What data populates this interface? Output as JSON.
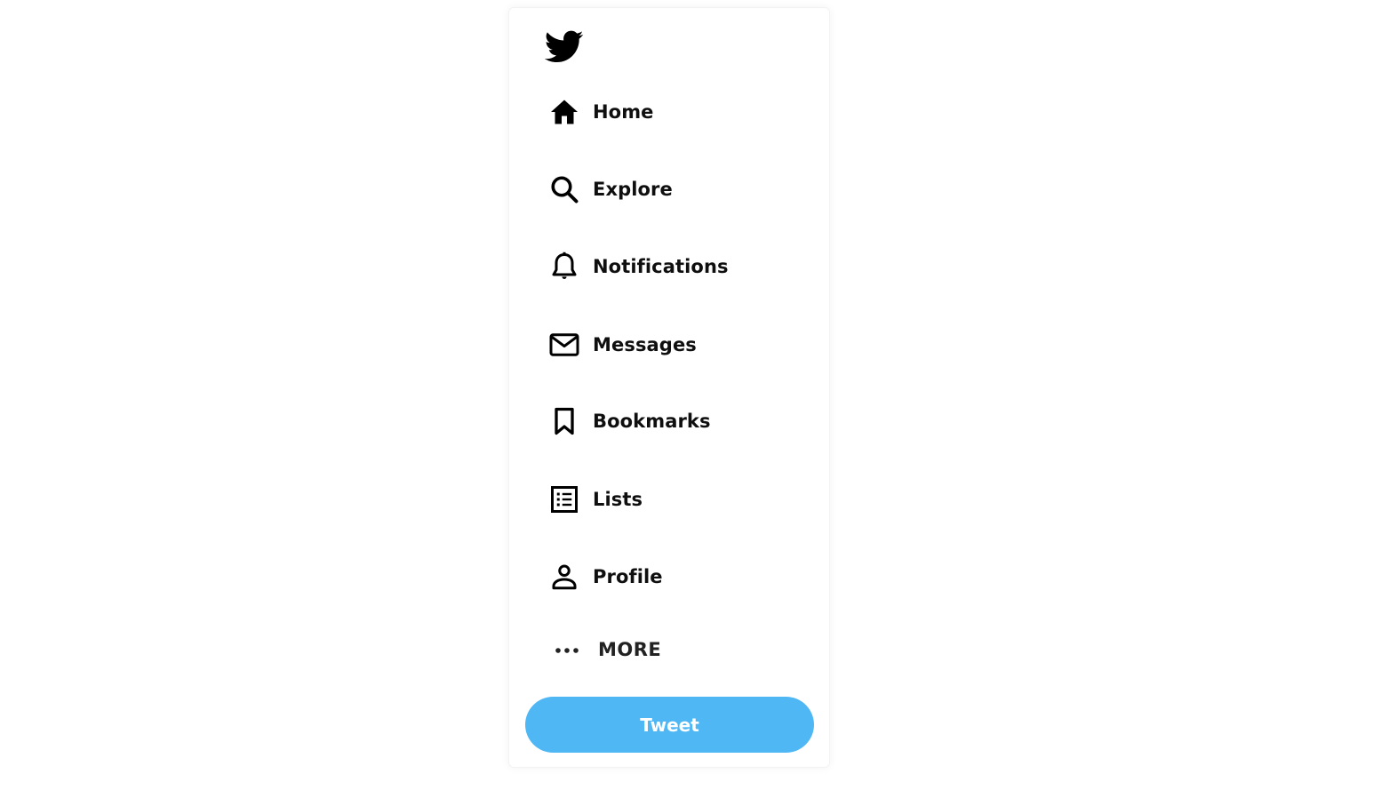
{
  "colors": {
    "accent": "#50b7f5",
    "text": "#0f0f0f",
    "background": "#ffffff"
  },
  "logo": {
    "icon": "twitter-bird-icon"
  },
  "nav": {
    "items": [
      {
        "label": "Home",
        "icon": "home-icon"
      },
      {
        "label": "Explore",
        "icon": "search-icon"
      },
      {
        "label": "Notifications",
        "icon": "bell-icon"
      },
      {
        "label": "Messages",
        "icon": "mail-icon"
      },
      {
        "label": "Bookmarks",
        "icon": "bookmark-icon"
      },
      {
        "label": "Lists",
        "icon": "list-icon"
      },
      {
        "label": "Profile",
        "icon": "user-icon"
      }
    ],
    "more": {
      "label": "MORE",
      "icon": "more-horizontal-icon"
    }
  },
  "tweet_button": {
    "label": "Tweet"
  }
}
